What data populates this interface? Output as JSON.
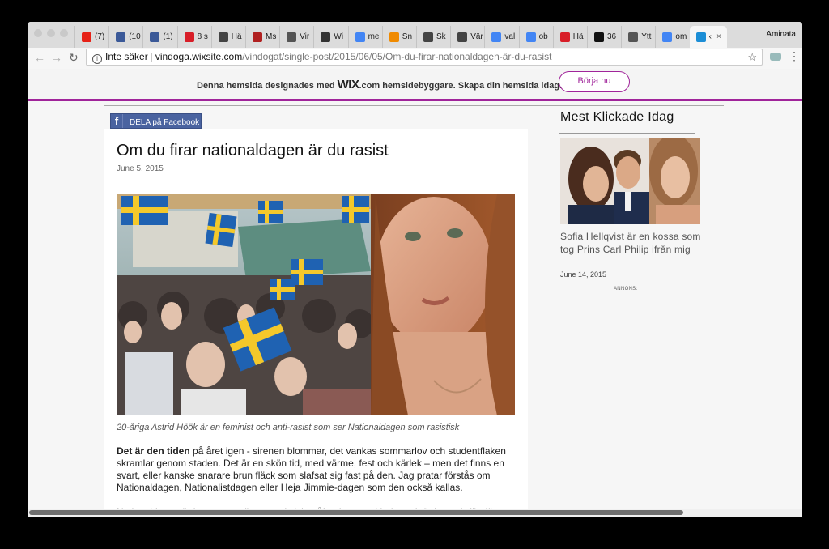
{
  "browser": {
    "tabs": [
      {
        "label": "(7)",
        "icon": "youtube-icon",
        "color": "#e62117"
      },
      {
        "label": "(10",
        "icon": "facebook-icon",
        "color": "#3b5998"
      },
      {
        "label": "(1)",
        "icon": "facebook-icon",
        "color": "#3b5998"
      },
      {
        "label": "8 s",
        "icon": "dn-icon",
        "color": "#d81e28"
      },
      {
        "label": "Hä",
        "icon": "svt-icon",
        "color": "#444444"
      },
      {
        "label": "Ms",
        "icon": "ms-icon",
        "color": "#b02020"
      },
      {
        "label": "Vir",
        "icon": "globe-icon",
        "color": "#555555"
      },
      {
        "label": "Wi",
        "icon": "wikipedia-icon",
        "color": "#333333"
      },
      {
        "label": "me",
        "icon": "google-icon",
        "color": "#4285f4"
      },
      {
        "label": "Sn",
        "icon": "sn-icon",
        "color": "#f08a00"
      },
      {
        "label": "Sk",
        "icon": "sk-icon",
        "color": "#444444"
      },
      {
        "label": "Vär",
        "icon": "var-icon",
        "color": "#444444"
      },
      {
        "label": "val",
        "icon": "google-icon",
        "color": "#4285f4"
      },
      {
        "label": "ob",
        "icon": "google-icon",
        "color": "#4285f4"
      },
      {
        "label": "Hä",
        "icon": "expressen-icon",
        "color": "#d81e28"
      },
      {
        "label": "36",
        "icon": "circle-icon",
        "color": "#111111"
      },
      {
        "label": "Ytt",
        "icon": "svd-icon",
        "color": "#555555"
      },
      {
        "label": "om",
        "icon": "google-icon",
        "color": "#4285f4"
      },
      {
        "label": "‹",
        "icon": "wix-tab-icon",
        "color": "#1c8ed6"
      }
    ],
    "profile_name": "Aminata",
    "address": {
      "security_label": "Inte säker",
      "host": "vindoga.wixsite.com",
      "path": "/vindogat/single-post/2015/06/05/Om-du-firar-nationaldagen-är-du-rasist"
    }
  },
  "wix_banner": {
    "text_before": "Denna hemsida designades med ",
    "logo": "WIX",
    "text_after": ".com hemsidebyggare. Skapa din hemsida idag.",
    "button_label": "Börja nu",
    "accent": "#a0249a"
  },
  "article": {
    "share_label": "DELA på Facebook",
    "title": "Om du firar nationaldagen är du rasist",
    "date": "June 5, 2015",
    "caption": "20-åriga Astrid Höök är en feminist och anti-rasist som ser Nationaldagen som rasistisk",
    "lead_bold": "Det är den tiden",
    "lead_rest": " på året igen - sirenen blommar, det vankas sommarlov och studentflaken skramlar genom staden. Det är en skön tid, med värme, fest och kärlek – men det finns en svart, eller kanske snarare brun fläck som slafsat sig fast på den. Jag pratar förstås om Nationaldagen, Nationalistdagen eller Heja Jimmie-dagen som den också kallas.",
    "next_paragraph": "Nationaldagen är inget annat än ett rasistiskt påfund som exkluderar, kränker och förolämpar"
  },
  "sidebar": {
    "title": "Mest Klickade Idag",
    "headline": "Sofia Hellqvist är en kossa som tog Prins Carl Philip ifrån mig",
    "date": "June 14, 2015",
    "ad_label": "ANNONS:"
  }
}
